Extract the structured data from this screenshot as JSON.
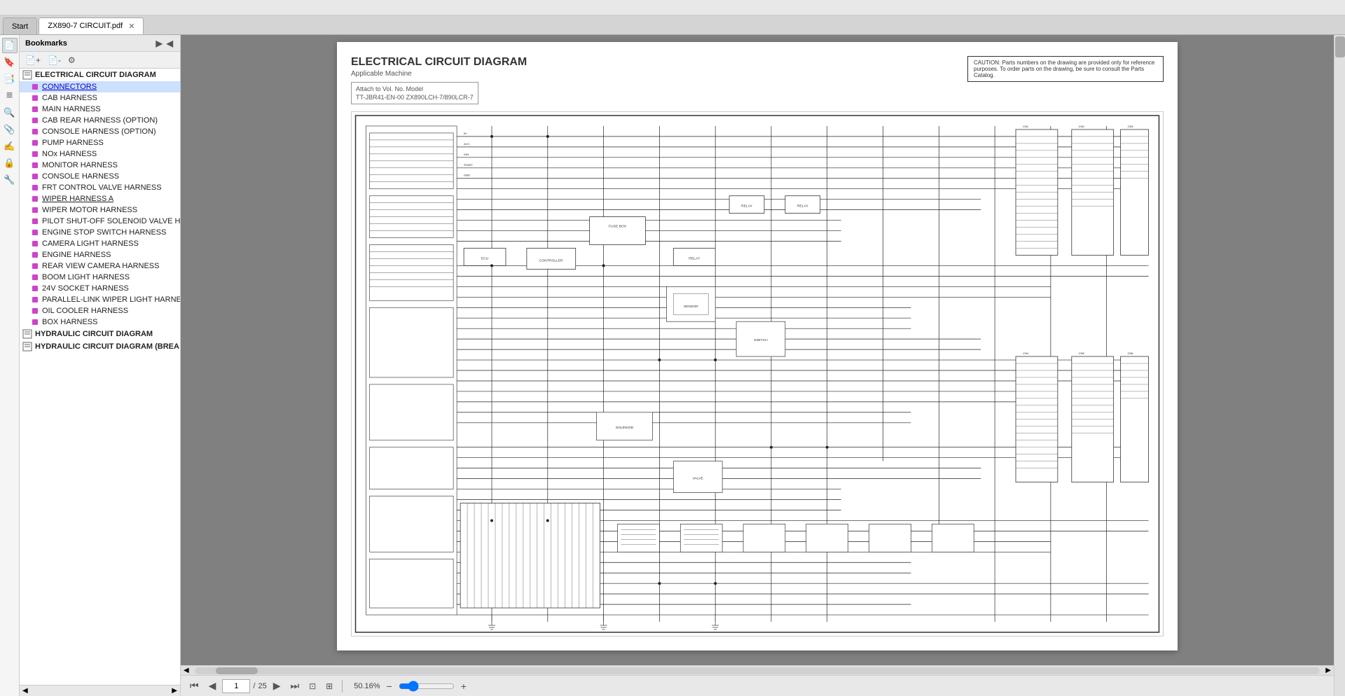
{
  "app": {
    "title": "ZX890-7 CIRCUIT.pdf"
  },
  "tabs": [
    {
      "id": "start",
      "label": "Start",
      "active": false,
      "closable": false
    },
    {
      "id": "pdf",
      "label": "ZX890-7 CIRCUIT.pdf",
      "active": true,
      "closable": true
    }
  ],
  "bookmarks": {
    "header": "Bookmarks",
    "items": [
      {
        "id": "electrical",
        "label": "ELECTRICAL CIRCUIT DIAGRAM",
        "level": 0,
        "type": "group"
      },
      {
        "id": "connectors",
        "label": "CONNECTORS",
        "level": 1,
        "type": "item",
        "is_link": true
      },
      {
        "id": "cab_harness",
        "label": "CAB HARNESS",
        "level": 1,
        "type": "item"
      },
      {
        "id": "main_harness",
        "label": "MAIN HARNESS",
        "level": 1,
        "type": "item"
      },
      {
        "id": "cab_rear_harness",
        "label": "CAB REAR HARNESS (OPTION)",
        "level": 1,
        "type": "item"
      },
      {
        "id": "console_harness_opt",
        "label": "CONSOLE HARNESS (OPTION)",
        "level": 1,
        "type": "item"
      },
      {
        "id": "pump_harness",
        "label": "PUMP HARNESS",
        "level": 1,
        "type": "item"
      },
      {
        "id": "nox_harness",
        "label": "NOx HARNESS",
        "level": 1,
        "type": "item"
      },
      {
        "id": "monitor_harness",
        "label": "MONITOR HARNESS",
        "level": 1,
        "type": "item"
      },
      {
        "id": "console_harness",
        "label": "CONSOLE HARNESS",
        "level": 1,
        "type": "item"
      },
      {
        "id": "frt_control",
        "label": "FRT CONTROL VALVE HARNESS",
        "level": 1,
        "type": "item"
      },
      {
        "id": "wiper_harness_a",
        "label": "WIPER HARNESS A",
        "level": 1,
        "type": "item",
        "underline": true
      },
      {
        "id": "wiper_motor",
        "label": "WIPER MOTOR HARNESS",
        "level": 1,
        "type": "item"
      },
      {
        "id": "pilot_shutoff",
        "label": "PILOT SHUT-OFF SOLENOID VALVE H",
        "level": 1,
        "type": "item"
      },
      {
        "id": "engine_stop",
        "label": "ENGINE STOP SWITCH HARNESS",
        "level": 1,
        "type": "item"
      },
      {
        "id": "camera_light",
        "label": "CAMERA LIGHT HARNESS",
        "level": 1,
        "type": "item"
      },
      {
        "id": "engine_harness",
        "label": "ENGINE HARNESS",
        "level": 1,
        "type": "item"
      },
      {
        "id": "rear_view_camera",
        "label": "REAR VIEW CAMERA HARNESS",
        "level": 1,
        "type": "item"
      },
      {
        "id": "boom_light",
        "label": "BOOM LIGHT HARNESS",
        "level": 1,
        "type": "item"
      },
      {
        "id": "socket_24v",
        "label": "24V SOCKET HARNESS",
        "level": 1,
        "type": "item"
      },
      {
        "id": "parallel_link",
        "label": "PARALLEL-LINK WIPER LIGHT HARNE",
        "level": 1,
        "type": "item"
      },
      {
        "id": "oil_cooler",
        "label": "OIL COOLER HARNESS",
        "level": 1,
        "type": "item"
      },
      {
        "id": "box_harness",
        "label": "BOX HARNESS",
        "level": 1,
        "type": "item"
      },
      {
        "id": "hydraulic_circuit",
        "label": "HYDRAULIC CIRCUIT DIAGRAM",
        "level": 0,
        "type": "group"
      },
      {
        "id": "hydraulic_circuit_brea",
        "label": "HYDRAULIC CIRCUIT DIAGRAM (BREA",
        "level": 0,
        "type": "group"
      }
    ]
  },
  "pdf": {
    "page_current": "1",
    "page_total": "25",
    "zoom": "50.16%",
    "diagram_title": "ELECTRICAL CIRCUIT DIAGRAM",
    "diagram_subtitle": "Applicable Machine",
    "diagram_meta_label": "Attach to Vol. No.",
    "diagram_meta_model": "Model",
    "diagram_meta_vol": "TT-JBR41-EN-00",
    "diagram_meta_model_val": "ZX890LCH-7/890LCR-7",
    "caution_text": "CAUTION: Parts numbers on the drawing are provided only for reference purposes.\nTo order parts on the drawing, be sure to consult the Parts Catalog."
  },
  "left_icons": [
    {
      "id": "open",
      "symbol": "📄",
      "label": "open"
    },
    {
      "id": "bookmark",
      "symbol": "🔖",
      "label": "bookmark"
    },
    {
      "id": "page",
      "symbol": "📑",
      "label": "page"
    },
    {
      "id": "layers",
      "symbol": "≡",
      "label": "layers"
    },
    {
      "id": "search",
      "symbol": "🔍",
      "label": "search"
    },
    {
      "id": "attachment",
      "symbol": "📎",
      "label": "attachment"
    },
    {
      "id": "signature",
      "symbol": "✍",
      "label": "signature"
    },
    {
      "id": "lock",
      "symbol": "🔒",
      "label": "lock"
    },
    {
      "id": "tools",
      "symbol": "🔧",
      "label": "tools"
    }
  ]
}
